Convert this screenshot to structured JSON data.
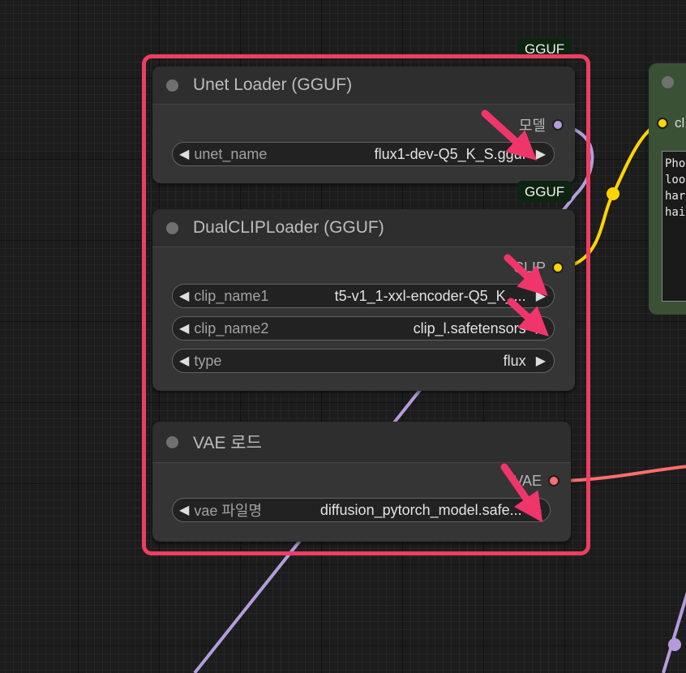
{
  "nodes": {
    "unet": {
      "title": "Unet Loader (GGUF)",
      "badge": "GGUF",
      "output": {
        "label": "모델",
        "color": "#b49cdc"
      },
      "widgets": [
        {
          "name": "unet_name",
          "value": "flux1-dev-Q5_K_S.gguf"
        }
      ]
    },
    "dualclip": {
      "title": "DualCLIPLoader (GGUF)",
      "badge": "GGUF",
      "output": {
        "label": "CLIP",
        "color": "#ffd500"
      },
      "widgets": [
        {
          "name": "clip_name1",
          "value": "t5-v1_1-xxl-encoder-Q5_K_..."
        },
        {
          "name": "clip_name2",
          "value": "clip_l.safetensors"
        },
        {
          "name": "type",
          "value": "flux"
        }
      ]
    },
    "vae": {
      "title": "VAE 로드",
      "output": {
        "label": "VAE",
        "color": "#ff6e6e"
      },
      "widgets": [
        {
          "name": "vae 파일명",
          "value": "diffusion_pytorch_model.safe..."
        }
      ]
    },
    "prompt": {
      "input_label": "cl",
      "text_lines": [
        "Pho",
        "loo",
        "har",
        "hai"
      ]
    }
  },
  "icons": {
    "widget_left": "◀",
    "widget_right": "▶"
  },
  "colors": {
    "highlight": "#ee3e62",
    "arrow": "#f0356a",
    "model_link": "#b49cdc",
    "clip_link": "#ffd500",
    "vae_link": "#ff6e6e",
    "prompt_node": "#3a5136"
  }
}
